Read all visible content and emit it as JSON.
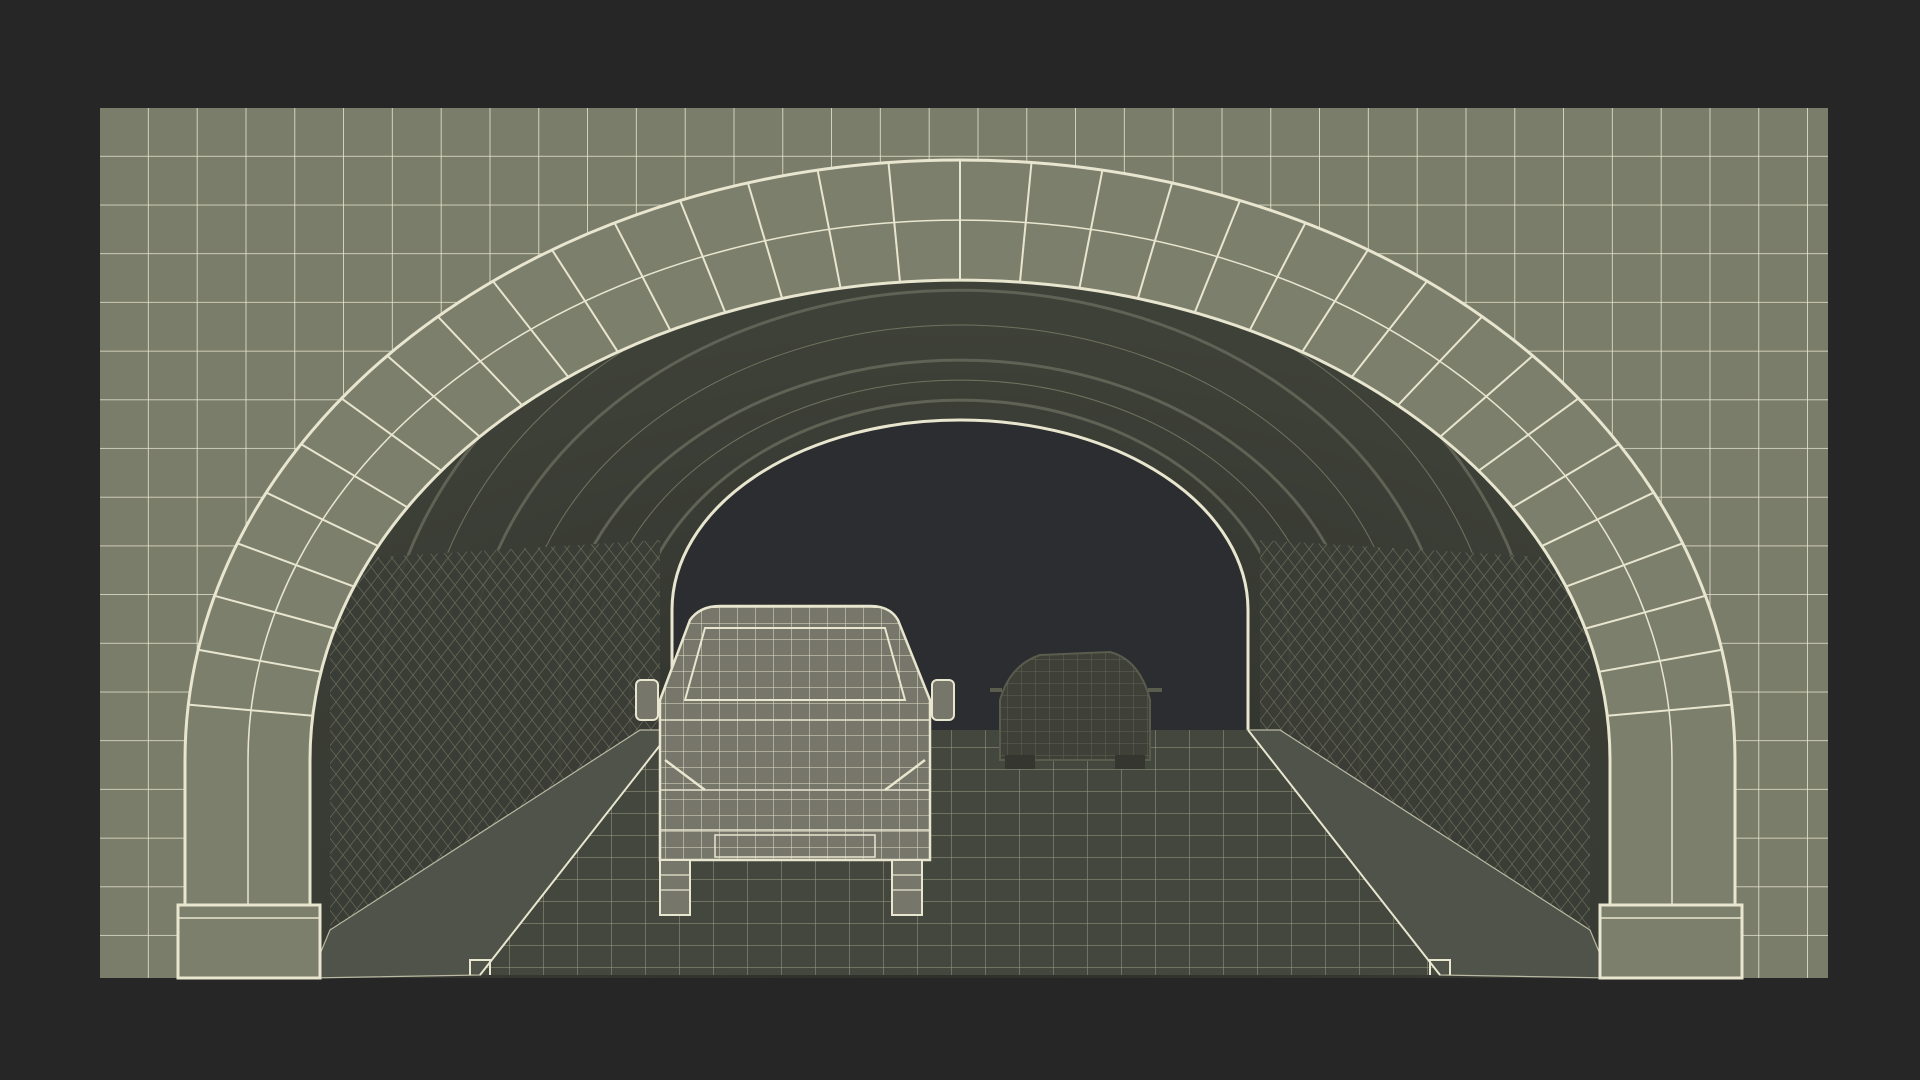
{
  "scene": {
    "subject": "tunnel-portal-wireframe-render",
    "colors": {
      "background": "#262626",
      "wall": "#7b7d6b",
      "wire": "#e8e6cf",
      "tunnel_interior": "#3c3f36",
      "tunnel_deep": "#2a2c27",
      "road": "#43463c",
      "sky_opening": "#2c2d30",
      "vehicle": "#747563",
      "vehicle_dark": "#3d3f37"
    },
    "objects": [
      "portal-wall",
      "stone-arch-ring",
      "tunnel-vault",
      "roadway",
      "left-sidewalk",
      "right-sidewalk",
      "van",
      "sedan"
    ]
  }
}
